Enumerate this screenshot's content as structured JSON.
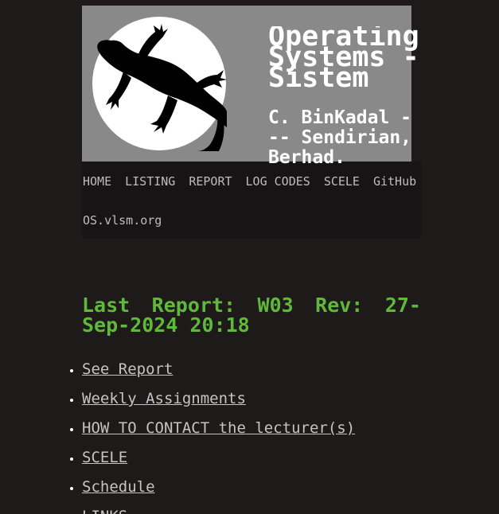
{
  "header": {
    "title": "Operating Systems - Sistem",
    "subtitle": "C. BinKadal --- Sendirian, Berhad."
  },
  "nav": {
    "items": [
      "HOME",
      "LISTING",
      "REPORT",
      "LOG CODES",
      "SCELE",
      "GitHub"
    ],
    "site_link": "OS.vlsm.org"
  },
  "main": {
    "report_heading": "Last Report: W03 Rev: 27-Sep-2024 20:18",
    "links": [
      "See Report",
      "Weekly Assignments",
      "HOW TO CONTACT the lecturer(s)",
      "SCELE",
      "Schedule",
      "LINKS"
    ]
  },
  "colors": {
    "background": "#1e1a1a",
    "header_bg": "#898989",
    "heading_green": "#5fb93a",
    "link_grey": "#c4c4c4"
  },
  "icons": {
    "logo": "gecko-in-circle-logo"
  }
}
